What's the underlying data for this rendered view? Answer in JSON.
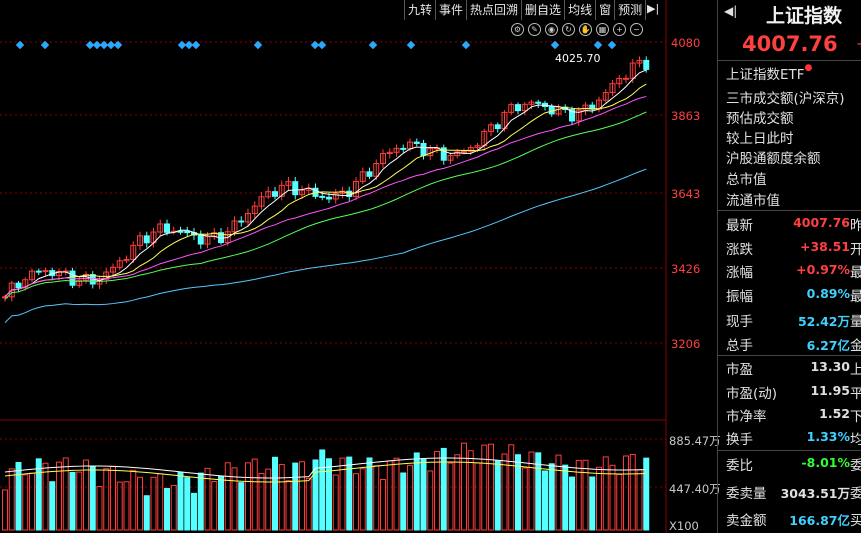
{
  "toolbar": {
    "buttons": [
      "九转",
      "事件",
      "热点回溯",
      "删自选",
      "均线",
      "窗",
      "预测"
    ],
    "arrow": "▶|"
  },
  "price_axis": {
    "ticks": [
      "4080",
      "3863",
      "3643",
      "3426",
      "3206"
    ]
  },
  "volume_axis": {
    "ticks": [
      "885.47万",
      "447.40万"
    ],
    "unit": "X100"
  },
  "high_marker": "4025.70",
  "side": {
    "title": "上证指数",
    "price": "4007.76",
    "price_trail": "+",
    "etf": "上证指数ETF",
    "info": [
      "三市成交额(沪深京)",
      "预估成交额",
      "较上日此时",
      "沪股通额度余额",
      "总市值",
      "流通市值"
    ],
    "quotes": [
      {
        "label": "最新",
        "value": "4007.76",
        "trail": "昨",
        "color": "#ff4040"
      },
      {
        "label": "涨跌",
        "value": "+38.51",
        "trail": "开",
        "color": "#ff4040"
      },
      {
        "label": "涨幅",
        "value": "+0.97%",
        "trail": "最",
        "color": "#ff4040"
      },
      {
        "label": "振幅",
        "value": "0.89%",
        "trail": "最",
        "color": "#40d0ff"
      },
      {
        "label": "现手",
        "value": "52.42万",
        "trail": "量",
        "color": "#40d0ff"
      },
      {
        "label": "总手",
        "value": "6.27亿",
        "trail": "金",
        "color": "#40d0ff"
      },
      {
        "label": "市盈",
        "value": "13.30",
        "trail": "上",
        "color": "#e0e0e0"
      },
      {
        "label": "市盈(动)",
        "value": "11.95",
        "trail": "平",
        "color": "#e0e0e0"
      },
      {
        "label": "市净率",
        "value": "1.52",
        "trail": "下",
        "color": "#e0e0e0"
      },
      {
        "label": "换手",
        "value": "1.33%",
        "trail": "均",
        "color": "#40d0ff"
      },
      {
        "label": "委比",
        "value": "-8.01%",
        "trail": "委",
        "color": "#30ff30"
      },
      {
        "label": "委卖量",
        "value": "3043.51万",
        "trail": "委",
        "color": "#e0e0e0"
      },
      {
        "label": "卖金额",
        "value": "166.87亿",
        "trail": "买",
        "color": "#40d0ff"
      }
    ]
  },
  "colors": {
    "up": "#ff3c3c",
    "down": "#54ffff",
    "ma5": "#ffffff",
    "ma10": "#ffff54",
    "ma20": "#ff54ff",
    "ma30": "#54ff54",
    "ma60": "#54c8ff"
  },
  "tools": [
    "gear-icon",
    "pen-icon",
    "eye-icon",
    "refresh-icon",
    "hand-icon",
    "table-icon",
    "zoom-in-icon",
    "zoom-out-icon"
  ]
}
